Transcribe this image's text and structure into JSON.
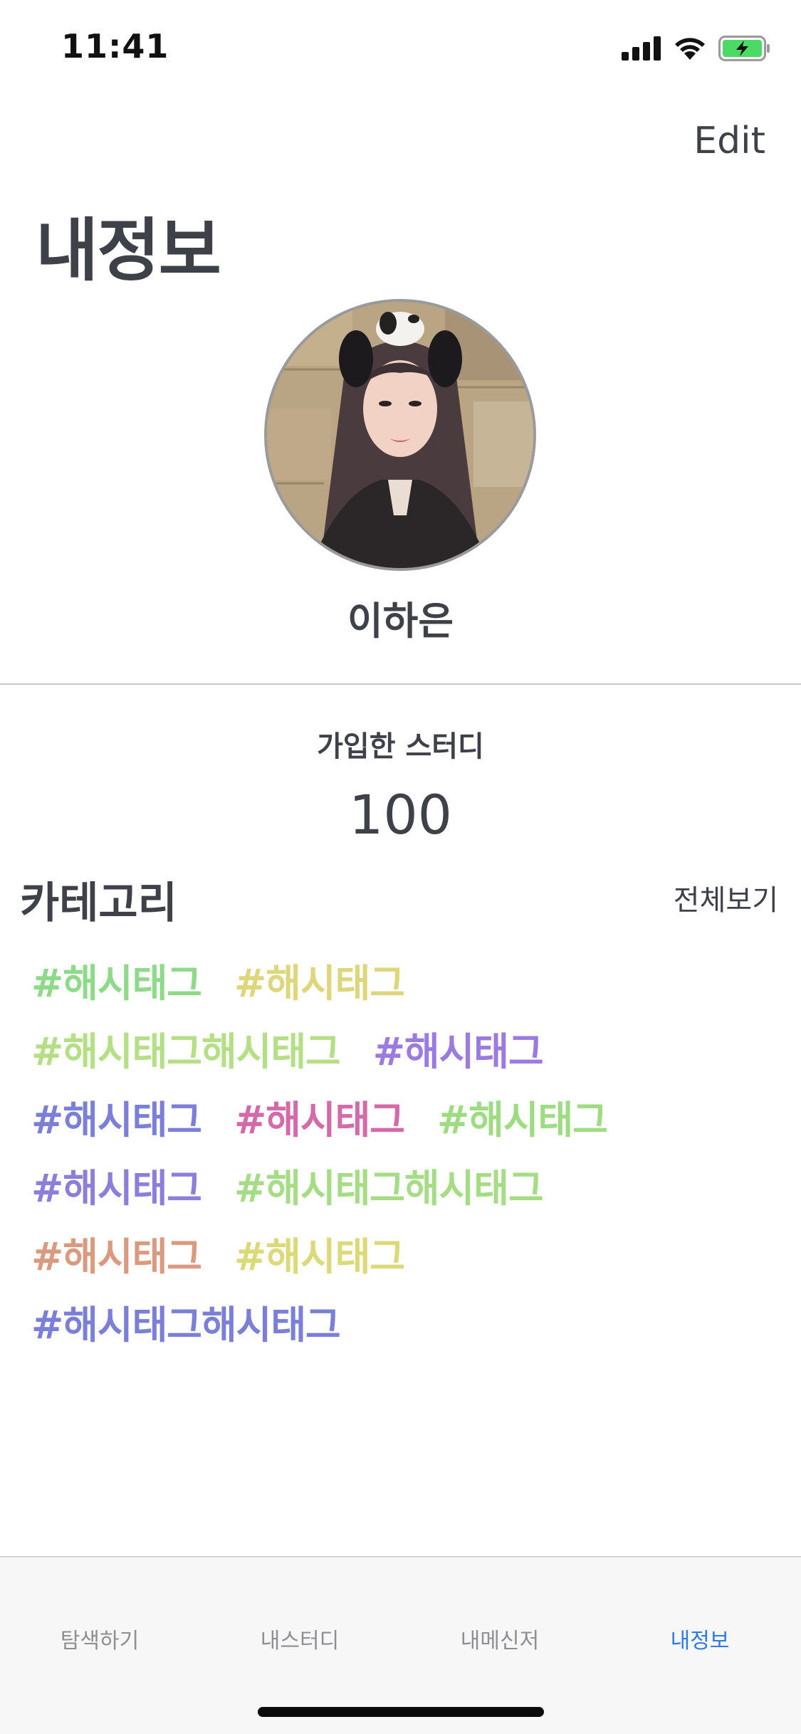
{
  "status_bar": {
    "time": "11:41",
    "icons": [
      "signal-icon",
      "wifi-icon",
      "battery-charging-icon"
    ],
    "battery_color": "#4cd964"
  },
  "header": {
    "edit_label": "Edit",
    "title": "내정보"
  },
  "profile": {
    "name": "이하은"
  },
  "studies": {
    "label": "가입한 스터디",
    "count": "100"
  },
  "category": {
    "title": "카테고리",
    "see_all_label": "전체보기",
    "rows": [
      [
        {
          "text": "#해시태그",
          "color": "#8fd98a"
        },
        {
          "text": "#해시태그",
          "color": "#ddd67c"
        }
      ],
      [
        {
          "text": "#해시태그해시태그",
          "color": "#b4df86"
        },
        {
          "text": "#해시태그",
          "color": "#9b7be0"
        }
      ],
      [
        {
          "text": "#해시태그",
          "color": "#7b7fd8"
        },
        {
          "text": "#해시태그",
          "color": "#d36aa9"
        },
        {
          "text": "#해시태그",
          "color": "#9fdb83"
        }
      ],
      [
        {
          "text": "#해시태그",
          "color": "#8d7fd9"
        },
        {
          "text": "#해시태그해시태그",
          "color": "#a7dc86"
        }
      ],
      [
        {
          "text": "#해시태그",
          "color": "#d99a80"
        },
        {
          "text": "#해시태그",
          "color": "#dcd978"
        }
      ],
      [
        {
          "text": "#해시태그해시태그",
          "color": "#7b7fd8"
        }
      ]
    ]
  },
  "tab_bar": {
    "items": [
      {
        "label": "탐색하기",
        "active": false
      },
      {
        "label": "내스터디",
        "active": false
      },
      {
        "label": "내메신저",
        "active": false
      },
      {
        "label": "내정보",
        "active": true
      }
    ],
    "active_color": "#2e7ae6"
  }
}
